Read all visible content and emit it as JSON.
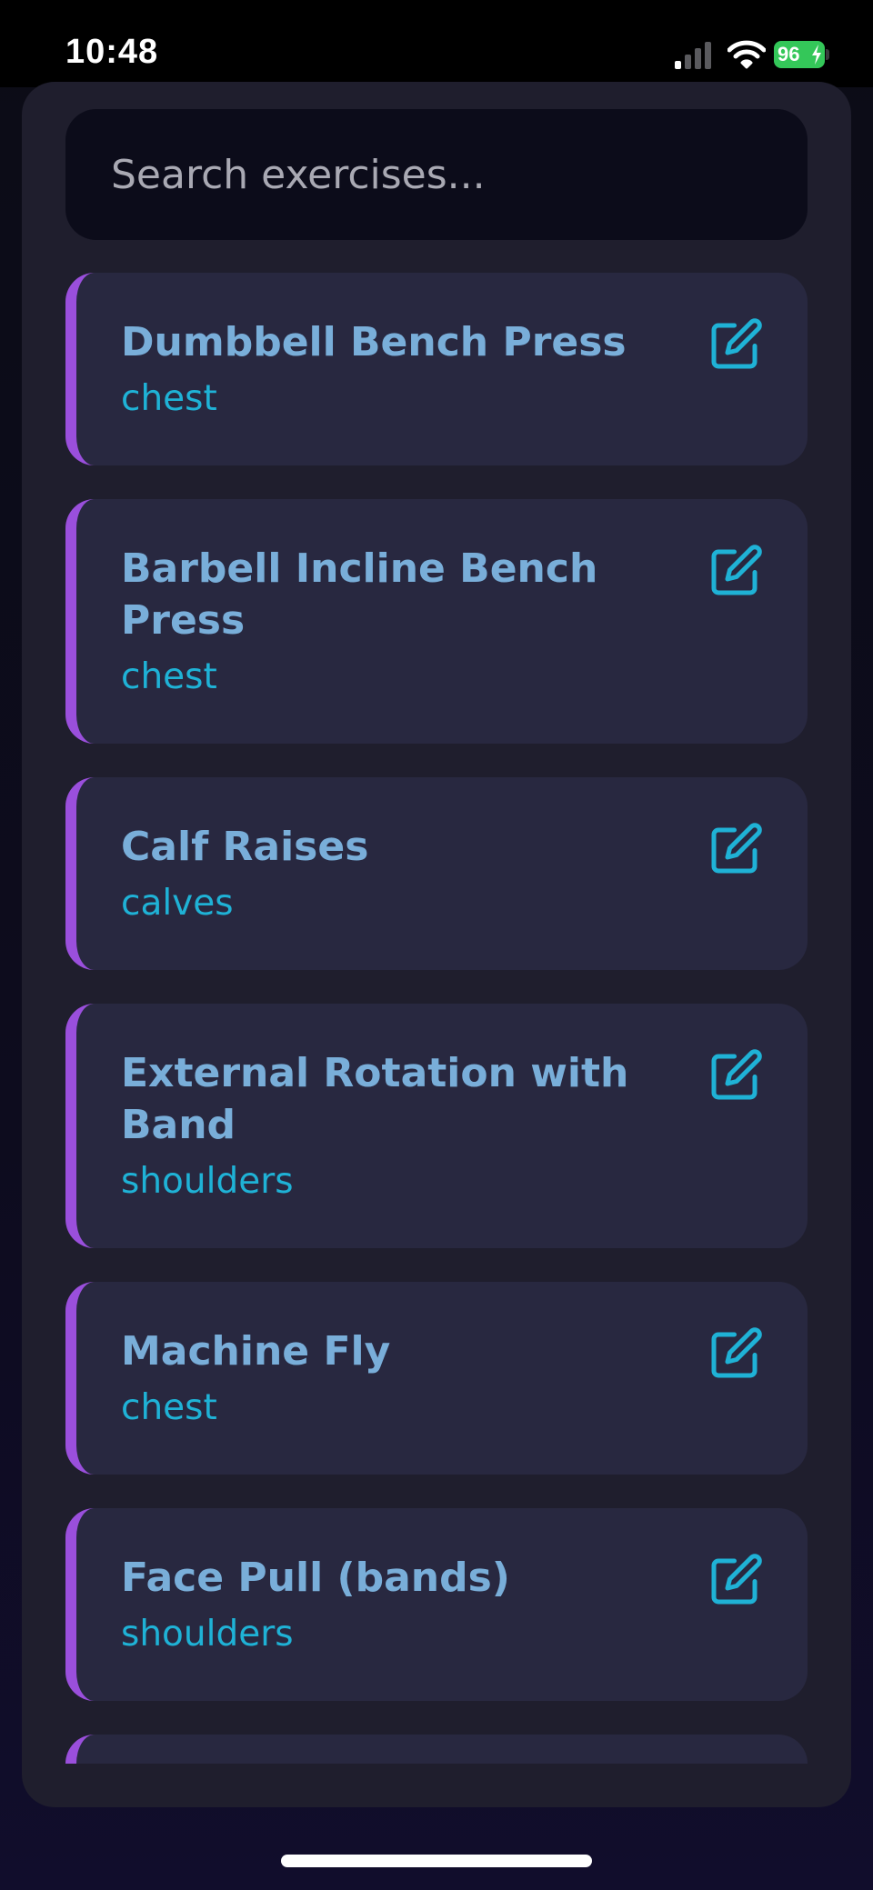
{
  "status_bar": {
    "time": "10:48",
    "battery": "96"
  },
  "search": {
    "placeholder": "Search exercises..."
  },
  "colors": {
    "accent": "#9a4fdc",
    "title": "#79aed9",
    "muscle": "#1fb2d6",
    "card": "#282840"
  },
  "exercises": [
    {
      "name": "Dumbbell Bench Press",
      "muscle": "chest",
      "edit_icon": "edit-icon"
    },
    {
      "name": "Barbell Incline Bench Press",
      "muscle": "chest",
      "edit_icon": "edit-icon"
    },
    {
      "name": "Calf Raises",
      "muscle": "calves",
      "edit_icon": "edit-icon"
    },
    {
      "name": "External Rotation with Band",
      "muscle": "shoulders",
      "edit_icon": "edit-icon"
    },
    {
      "name": "Machine Fly",
      "muscle": "chest",
      "edit_icon": "edit-icon"
    },
    {
      "name": "Face Pull (bands)",
      "muscle": "shoulders",
      "edit_icon": "edit-icon"
    },
    {
      "name": "",
      "muscle": "",
      "edit_icon": "edit-icon"
    }
  ]
}
